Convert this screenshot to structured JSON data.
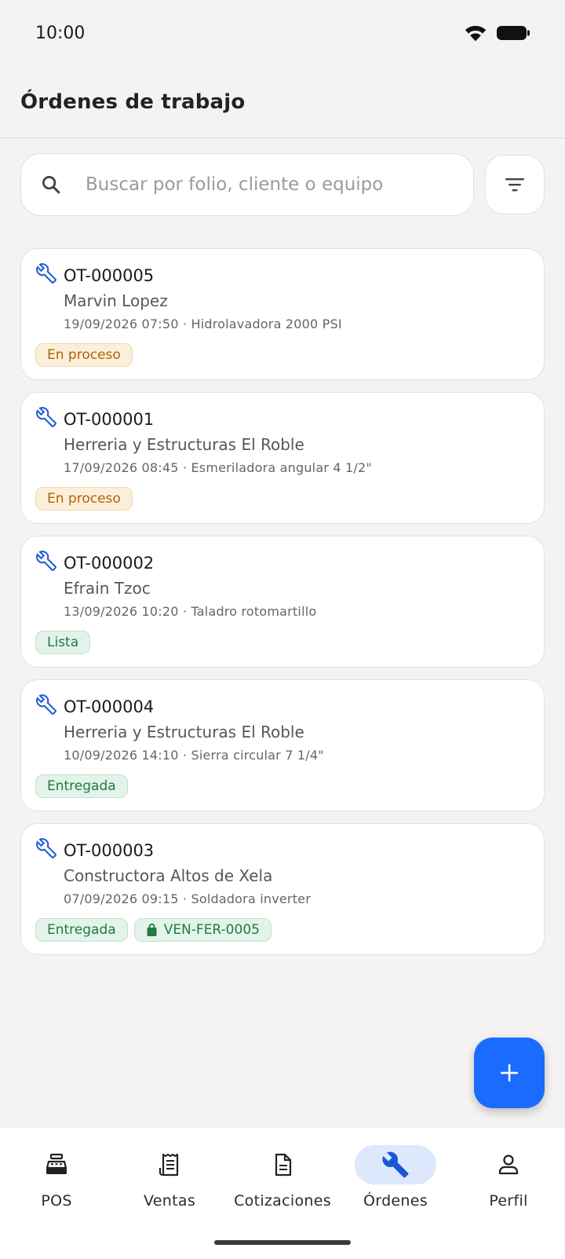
{
  "status_bar": {
    "time": "10:00"
  },
  "header": {
    "title": "Órdenes de trabajo"
  },
  "search": {
    "placeholder": "Buscar por folio, cliente o equipo",
    "value": ""
  },
  "orders": [
    {
      "folio": "OT-000005",
      "client": "Marvin Lopez",
      "meta": "19/09/2026 07:50 · Hidrolavadora 2000 PSI",
      "status": "En proceso"
    },
    {
      "folio": "OT-000001",
      "client": "Herreria y Estructuras El Roble",
      "meta": "17/09/2026 08:45 · Esmeriladora angular 4 1/2\"",
      "status": "En proceso"
    },
    {
      "folio": "OT-000002",
      "client": "Efrain Tzoc",
      "meta": "13/09/2026 10:20 · Taladro rotomartillo",
      "status": "Lista"
    },
    {
      "folio": "OT-000004",
      "client": "Herreria y Estructuras El Roble",
      "meta": "10/09/2026 14:10 · Sierra circular 7 1/4\"",
      "status": "Entregada"
    },
    {
      "folio": "OT-000003",
      "client": "Constructora Altos de Xela",
      "meta": "07/09/2026 09:15 · Soldadora inverter",
      "status": "Entregada",
      "sale": "VEN-FER-0005"
    }
  ],
  "nav": {
    "items": [
      {
        "label": "POS",
        "icon": "cash-register-icon"
      },
      {
        "label": "Ventas",
        "icon": "receipt-icon"
      },
      {
        "label": "Cotizaciones",
        "icon": "document-icon"
      },
      {
        "label": "Órdenes",
        "icon": "wrench-icon",
        "active": true
      },
      {
        "label": "Perfil",
        "icon": "person-icon"
      }
    ]
  },
  "colors": {
    "accent": "#1a6cff",
    "background": "#f5f3f2",
    "status_proceso": "#a8670a",
    "status_done": "#1f7a44",
    "wrench": "#1f5fd6"
  }
}
